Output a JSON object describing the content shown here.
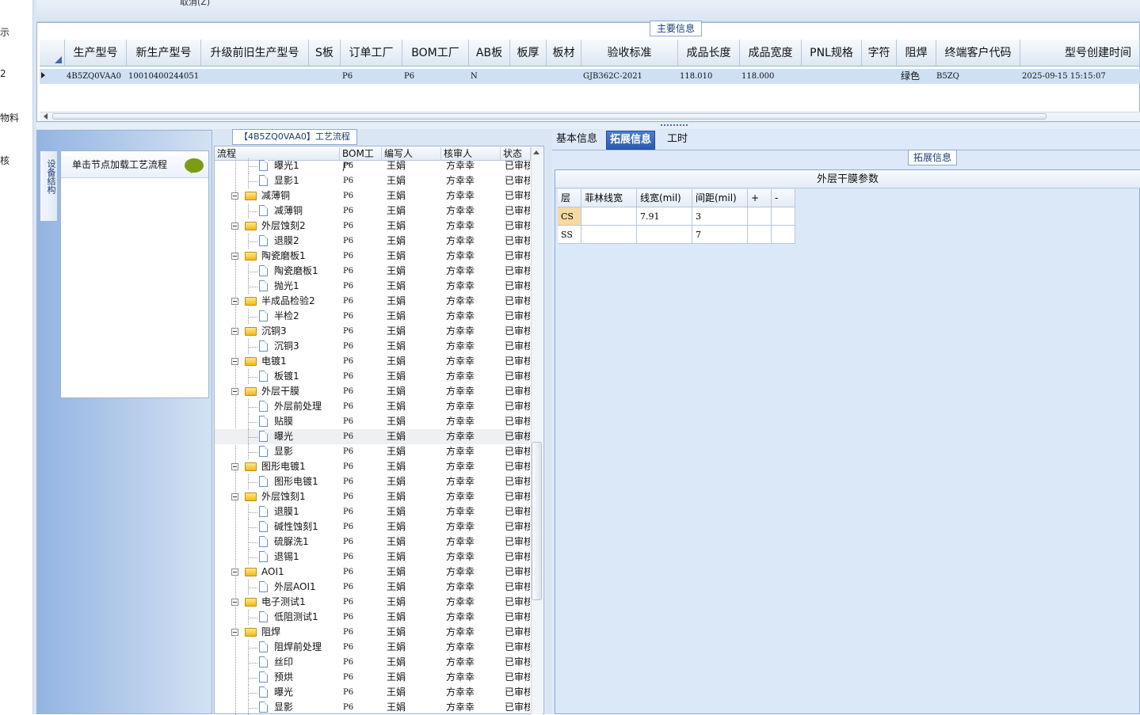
{
  "left_strip": [
    "示",
    "2",
    "物料",
    "核"
  ],
  "top_bar": {
    "cancel_label": "取消(Z)"
  },
  "main_info": {
    "legend": "主要信息",
    "columns": [
      "生产型号",
      "新生产型号",
      "升级前旧生产型号",
      "S板",
      "订单工厂",
      "BOM工厂",
      "AB板",
      "板厚",
      "板材",
      "验收标准",
      "成品长度",
      "成品宽度",
      "PNL规格",
      "字符",
      "阻焊",
      "终端客户代码",
      "型号创建时间"
    ],
    "row": {
      "生产型号": "4B5ZQ0VAA0",
      "新生产型号": "10010400244051",
      "升级前旧生产型号": "",
      "S板": "",
      "订单工厂": "P6",
      "BOM工厂": "P6",
      "AB板": "N",
      "板厚": "",
      "板材": "",
      "验收标准": "GJB362C-2021",
      "成品长度": "118.010",
      "成品宽度": "118.000",
      "PNL规格": "",
      "字符": "",
      "阻焊": "绿色",
      "终端客户代码": "B5ZQ",
      "型号创建时间": "2025-09-15 15:15:07"
    }
  },
  "left_panel": {
    "vertical_tab": "设备结构",
    "node_title": "单击节点加载工艺流程"
  },
  "process": {
    "title": "【4B5ZQ0VAA0】工艺流程",
    "columns": [
      "流程",
      "BOM工厂",
      "编写人",
      "核审人",
      "状态"
    ],
    "rows": [
      {
        "level": 2,
        "name": "曝光1",
        "bom": "P6",
        "writer": "王娟",
        "reviewer": "方幸幸",
        "status": "已审核"
      },
      {
        "level": 2,
        "name": "显影1",
        "bom": "P6",
        "writer": "王娟",
        "reviewer": "方幸幸",
        "status": "已审核"
      },
      {
        "level": 1,
        "name": "减薄铜",
        "bom": "P6",
        "writer": "王娟",
        "reviewer": "方幸幸",
        "status": "已审核"
      },
      {
        "level": 2,
        "name": "减薄铜",
        "bom": "P6",
        "writer": "王娟",
        "reviewer": "方幸幸",
        "status": "已审核"
      },
      {
        "level": 1,
        "name": "外层蚀刻2",
        "bom": "P6",
        "writer": "王娟",
        "reviewer": "方幸幸",
        "status": "已审核"
      },
      {
        "level": 2,
        "name": "退膜2",
        "bom": "P6",
        "writer": "王娟",
        "reviewer": "方幸幸",
        "status": "已审核"
      },
      {
        "level": 1,
        "name": "陶瓷磨板1",
        "bom": "P6",
        "writer": "王娟",
        "reviewer": "方幸幸",
        "status": "已审核"
      },
      {
        "level": 2,
        "name": "陶瓷磨板1",
        "bom": "P6",
        "writer": "王娟",
        "reviewer": "方幸幸",
        "status": "已审核"
      },
      {
        "level": 2,
        "name": "抛光1",
        "bom": "P6",
        "writer": "王娟",
        "reviewer": "方幸幸",
        "status": "已审核"
      },
      {
        "level": 1,
        "name": "半成品检验2",
        "bom": "P6",
        "writer": "王娟",
        "reviewer": "方幸幸",
        "status": "已审核"
      },
      {
        "level": 2,
        "name": "半检2",
        "bom": "P6",
        "writer": "王娟",
        "reviewer": "方幸幸",
        "status": "已审核"
      },
      {
        "level": 1,
        "name": "沉铜3",
        "bom": "P6",
        "writer": "王娟",
        "reviewer": "方幸幸",
        "status": "已审核"
      },
      {
        "level": 2,
        "name": "沉铜3",
        "bom": "P6",
        "writer": "王娟",
        "reviewer": "方幸幸",
        "status": "已审核"
      },
      {
        "level": 1,
        "name": "电镀1",
        "bom": "P6",
        "writer": "王娟",
        "reviewer": "方幸幸",
        "status": "已审核"
      },
      {
        "level": 2,
        "name": "板镀1",
        "bom": "P6",
        "writer": "王娟",
        "reviewer": "方幸幸",
        "status": "已审核"
      },
      {
        "level": 1,
        "name": "外层干膜",
        "bom": "P6",
        "writer": "王娟",
        "reviewer": "方幸幸",
        "status": "已审核"
      },
      {
        "level": 2,
        "name": "外层前处理",
        "bom": "P6",
        "writer": "王娟",
        "reviewer": "方幸幸",
        "status": "已审核"
      },
      {
        "level": 2,
        "name": "贴膜",
        "bom": "P6",
        "writer": "王娟",
        "reviewer": "方幸幸",
        "status": "已审核"
      },
      {
        "level": 2,
        "name": "曝光",
        "bom": "P6",
        "writer": "王娟",
        "reviewer": "方幸幸",
        "status": "已审核",
        "selected": true
      },
      {
        "level": 2,
        "name": "显影",
        "bom": "P6",
        "writer": "王娟",
        "reviewer": "方幸幸",
        "status": "已审核"
      },
      {
        "level": 1,
        "name": "图形电镀1",
        "bom": "P6",
        "writer": "王娟",
        "reviewer": "方幸幸",
        "status": "已审核"
      },
      {
        "level": 2,
        "name": "图形电镀1",
        "bom": "P6",
        "writer": "王娟",
        "reviewer": "方幸幸",
        "status": "已审核"
      },
      {
        "level": 1,
        "name": "外层蚀刻1",
        "bom": "P6",
        "writer": "王娟",
        "reviewer": "方幸幸",
        "status": "已审核"
      },
      {
        "level": 2,
        "name": "退膜1",
        "bom": "P6",
        "writer": "王娟",
        "reviewer": "方幸幸",
        "status": "已审核"
      },
      {
        "level": 2,
        "name": "碱性蚀刻1",
        "bom": "P6",
        "writer": "王娟",
        "reviewer": "方幸幸",
        "status": "已审核"
      },
      {
        "level": 2,
        "name": "硫脲洗1",
        "bom": "P6",
        "writer": "王娟",
        "reviewer": "方幸幸",
        "status": "已审核"
      },
      {
        "level": 2,
        "name": "退锡1",
        "bom": "P6",
        "writer": "王娟",
        "reviewer": "方幸幸",
        "status": "已审核"
      },
      {
        "level": 1,
        "name": "AOI1",
        "bom": "P6",
        "writer": "王娟",
        "reviewer": "方幸幸",
        "status": "已审核"
      },
      {
        "level": 2,
        "name": "外层AOI1",
        "bom": "P6",
        "writer": "王娟",
        "reviewer": "方幸幸",
        "status": "已审核"
      },
      {
        "level": 1,
        "name": "电子测试1",
        "bom": "P6",
        "writer": "王娟",
        "reviewer": "方幸幸",
        "status": "已审核"
      },
      {
        "level": 2,
        "name": "低阻测试1",
        "bom": "P6",
        "writer": "王娟",
        "reviewer": "方幸幸",
        "status": "已审核"
      },
      {
        "level": 1,
        "name": "阻焊",
        "bom": "P6",
        "writer": "王娟",
        "reviewer": "方幸幸",
        "status": "已审核"
      },
      {
        "level": 2,
        "name": "阻焊前处理",
        "bom": "P6",
        "writer": "王娟",
        "reviewer": "方幸幸",
        "status": "已审核"
      },
      {
        "level": 2,
        "name": "丝印",
        "bom": "P6",
        "writer": "王娟",
        "reviewer": "方幸幸",
        "status": "已审核"
      },
      {
        "level": 2,
        "name": "预烘",
        "bom": "P6",
        "writer": "王娟",
        "reviewer": "方幸幸",
        "status": "已审核"
      },
      {
        "level": 2,
        "name": "曝光",
        "bom": "P6",
        "writer": "王娟",
        "reviewer": "方幸幸",
        "status": "已审核"
      },
      {
        "level": 2,
        "name": "显影",
        "bom": "P6",
        "writer": "王娟",
        "reviewer": "方幸幸",
        "status": "已审核"
      }
    ]
  },
  "right_panel": {
    "tabs": [
      {
        "label": "基本信息"
      },
      {
        "label": "拓展信息",
        "active": true
      },
      {
        "label": "工时"
      }
    ],
    "legend": "拓展信息",
    "table_title": "外层干膜参数",
    "param_columns": [
      "层",
      "菲林线宽",
      "线宽(mil)",
      "间距(mil)",
      "+",
      "-"
    ],
    "param_rows": [
      [
        "CS",
        "",
        "7.91",
        "3",
        "",
        ""
      ],
      [
        "SS",
        "",
        "",
        "7",
        "",
        ""
      ]
    ]
  },
  "colors": {
    "accent": "#2b5bb0",
    "selected_row": "#cfe0f5",
    "highlight_cell": "#f7d9a3",
    "panel_bg": "#dbe6f4"
  }
}
